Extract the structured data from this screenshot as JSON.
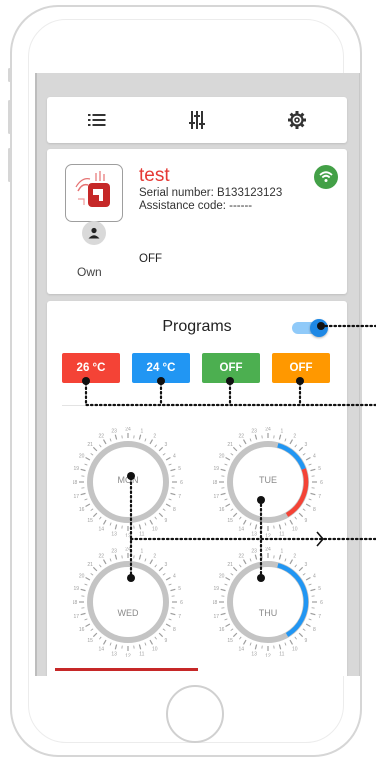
{
  "toolbar": {
    "items": [
      {
        "icon": "list-icon"
      },
      {
        "icon": "sliders-icon"
      },
      {
        "icon": "gear-icon"
      }
    ]
  },
  "device": {
    "name": "test",
    "serial": "Serial number: B133123123",
    "assistance": "Assistance code: ------",
    "role": "Own",
    "state": "OFF",
    "connection_icon": "wifi-icon",
    "connection_color": "#43a047"
  },
  "programs": {
    "title": "Programs",
    "toggle_on": true,
    "chips": [
      {
        "label": "26 °C",
        "color": "#f44336"
      },
      {
        "label": "24 °C",
        "color": "#2196f3"
      },
      {
        "label": "OFF",
        "color": "#4caf50"
      },
      {
        "label": "OFF",
        "color": "#ff9800"
      }
    ],
    "days": [
      {
        "label": "MON"
      },
      {
        "label": "TUE"
      },
      {
        "label": "WED"
      },
      {
        "label": "THU"
      }
    ]
  }
}
